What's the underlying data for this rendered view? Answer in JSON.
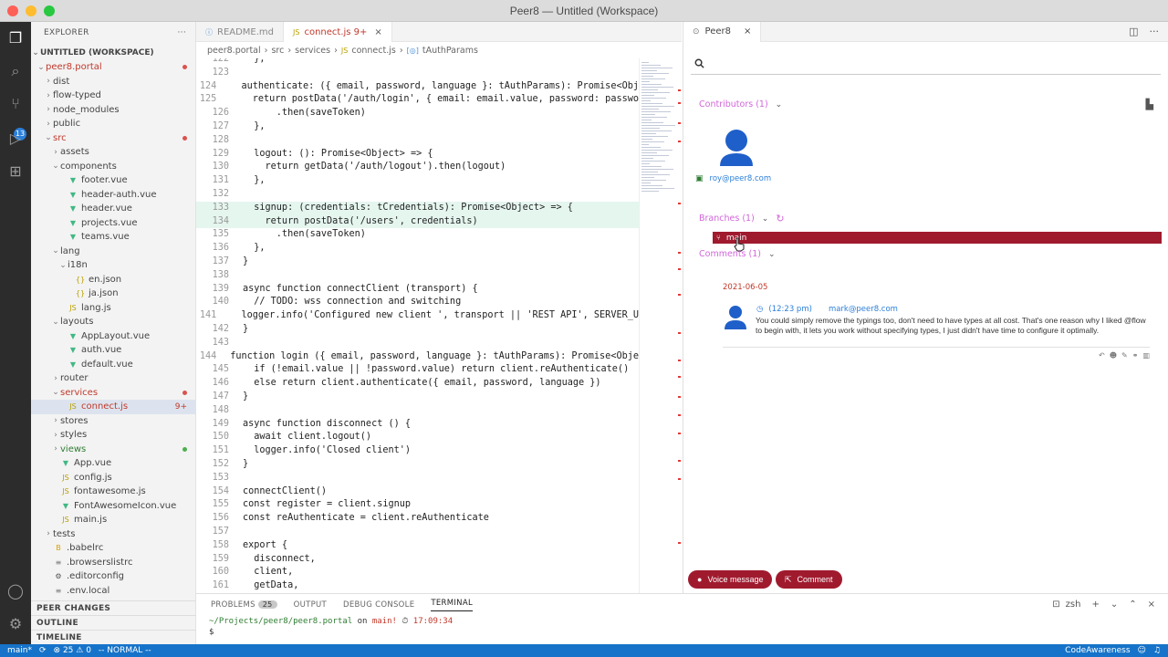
{
  "window": {
    "title": "Peer8 — Untitled (Workspace)"
  },
  "sidebar": {
    "header": "EXPLORER",
    "workspace": "UNTITLED (WORKSPACE)",
    "items": [
      {
        "label": "peer8.portal",
        "depth": 0,
        "chev": "v",
        "kind": "folder",
        "color": "red",
        "dot": "#d9534f"
      },
      {
        "label": "dist",
        "depth": 1,
        "chev": ">",
        "kind": "folder",
        "color": ""
      },
      {
        "label": "flow-typed",
        "depth": 1,
        "chev": ">",
        "kind": "folder",
        "color": ""
      },
      {
        "label": "node_modules",
        "depth": 1,
        "chev": ">",
        "kind": "folder",
        "color": ""
      },
      {
        "label": "public",
        "depth": 1,
        "chev": ">",
        "kind": "folder",
        "color": ""
      },
      {
        "label": "src",
        "depth": 1,
        "chev": "v",
        "kind": "folder",
        "color": "red",
        "dot": "#d9534f"
      },
      {
        "label": "assets",
        "depth": 2,
        "chev": ">",
        "kind": "folder",
        "color": ""
      },
      {
        "label": "components",
        "depth": 2,
        "chev": "v",
        "kind": "folder",
        "color": ""
      },
      {
        "label": "footer.vue",
        "depth": 3,
        "chev": "",
        "kind": "vue",
        "color": ""
      },
      {
        "label": "header-auth.vue",
        "depth": 3,
        "chev": "",
        "kind": "vue",
        "color": ""
      },
      {
        "label": "header.vue",
        "depth": 3,
        "chev": "",
        "kind": "vue",
        "color": ""
      },
      {
        "label": "projects.vue",
        "depth": 3,
        "chev": "",
        "kind": "vue",
        "color": ""
      },
      {
        "label": "teams.vue",
        "depth": 3,
        "chev": "",
        "kind": "vue",
        "color": ""
      },
      {
        "label": "lang",
        "depth": 2,
        "chev": "v",
        "kind": "folder",
        "color": ""
      },
      {
        "label": "i18n",
        "depth": 3,
        "chev": "v",
        "kind": "folder",
        "color": ""
      },
      {
        "label": "en.json",
        "depth": 4,
        "chev": "",
        "kind": "json",
        "color": ""
      },
      {
        "label": "ja.json",
        "depth": 4,
        "chev": "",
        "kind": "json",
        "color": ""
      },
      {
        "label": "lang.js",
        "depth": 3,
        "chev": "",
        "kind": "js",
        "color": ""
      },
      {
        "label": "layouts",
        "depth": 2,
        "chev": "v",
        "kind": "folder",
        "color": ""
      },
      {
        "label": "AppLayout.vue",
        "depth": 3,
        "chev": "",
        "kind": "vue",
        "color": ""
      },
      {
        "label": "auth.vue",
        "depth": 3,
        "chev": "",
        "kind": "vue",
        "color": ""
      },
      {
        "label": "default.vue",
        "depth": 3,
        "chev": "",
        "kind": "vue",
        "color": ""
      },
      {
        "label": "router",
        "depth": 2,
        "chev": ">",
        "kind": "folder",
        "color": ""
      },
      {
        "label": "services",
        "depth": 2,
        "chev": "v",
        "kind": "folder",
        "color": "red",
        "dot": "#d9534f"
      },
      {
        "label": "connect.js",
        "depth": 3,
        "chev": "",
        "kind": "js",
        "color": "red",
        "badge": "9+",
        "selected": true
      },
      {
        "label": "stores",
        "depth": 2,
        "chev": ">",
        "kind": "folder",
        "color": ""
      },
      {
        "label": "styles",
        "depth": 2,
        "chev": ">",
        "kind": "folder",
        "color": ""
      },
      {
        "label": "views",
        "depth": 2,
        "chev": ">",
        "kind": "folder",
        "color": "green",
        "dot": "#4caf50"
      },
      {
        "label": "App.vue",
        "depth": 2,
        "chev": "",
        "kind": "vue",
        "color": ""
      },
      {
        "label": "config.js",
        "depth": 2,
        "chev": "",
        "kind": "js",
        "color": ""
      },
      {
        "label": "fontawesome.js",
        "depth": 2,
        "chev": "",
        "kind": "js",
        "color": ""
      },
      {
        "label": "FontAwesomeIcon.vue",
        "depth": 2,
        "chev": "",
        "kind": "vue",
        "color": ""
      },
      {
        "label": "main.js",
        "depth": 2,
        "chev": "",
        "kind": "js",
        "color": ""
      },
      {
        "label": "tests",
        "depth": 1,
        "chev": ">",
        "kind": "folder",
        "color": ""
      },
      {
        "label": ".babelrc",
        "depth": 1,
        "chev": "",
        "kind": "babel",
        "color": ""
      },
      {
        "label": ".browserslistrc",
        "depth": 1,
        "chev": "",
        "kind": "text",
        "color": ""
      },
      {
        "label": ".editorconfig",
        "depth": 1,
        "chev": "",
        "kind": "gear",
        "color": ""
      },
      {
        "label": ".env.local",
        "depth": 1,
        "chev": "",
        "kind": "text",
        "color": ""
      }
    ],
    "bottom": [
      "PEER CHANGES",
      "OUTLINE",
      "TIMELINE"
    ]
  },
  "editor": {
    "tabs": [
      {
        "label": "README.md",
        "icon": "ⓘ",
        "active": false,
        "extra": ""
      },
      {
        "label": "connect.js 9+",
        "icon": "JS",
        "active": true,
        "extra": "×"
      }
    ],
    "breadcrumb": [
      "peer8.portal",
      "src",
      "services",
      "connect.js",
      "tAuthParams"
    ],
    "lines": [
      {
        "n": "122",
        "t": "  },",
        "hl": false
      },
      {
        "n": "123",
        "t": "",
        "hl": false
      },
      {
        "n": "124",
        "t": "  authenticate: ({ email, password, language }: tAuthParams): Promise<Obj",
        "hl": false
      },
      {
        "n": "125",
        "t": "    return postData('/auth/login', { email: email.value, password: passwo",
        "hl": false
      },
      {
        "n": "126",
        "t": "      .then(saveToken)",
        "hl": false
      },
      {
        "n": "127",
        "t": "  },",
        "hl": false
      },
      {
        "n": "128",
        "t": "",
        "hl": false
      },
      {
        "n": "129",
        "t": "  logout: (): Promise<Object> => {",
        "hl": false
      },
      {
        "n": "130",
        "t": "    return getData('/auth/logout').then(logout)",
        "hl": false
      },
      {
        "n": "131",
        "t": "  },",
        "hl": false
      },
      {
        "n": "132",
        "t": "",
        "hl": false
      },
      {
        "n": "133",
        "t": "  signup: (credentials: tCredentials): Promise<Object> => {",
        "hl": true
      },
      {
        "n": "134",
        "t": "    return postData('/users', credentials)",
        "hl": true
      },
      {
        "n": "135",
        "t": "      .then(saveToken)",
        "hl": false
      },
      {
        "n": "136",
        "t": "  },",
        "hl": false
      },
      {
        "n": "137",
        "t": "}",
        "hl": false
      },
      {
        "n": "138",
        "t": "",
        "hl": false
      },
      {
        "n": "139",
        "t": "async function connectClient (transport) {",
        "hl": false
      },
      {
        "n": "140",
        "t": "  // TODO: wss connection and switching",
        "hl": false
      },
      {
        "n": "141",
        "t": "  logger.info('Configured new client ', transport || 'REST API', SERVER_U",
        "hl": false
      },
      {
        "n": "142",
        "t": "}",
        "hl": false
      },
      {
        "n": "143",
        "t": "",
        "hl": false
      },
      {
        "n": "144",
        "t": "function login ({ email, password, language }: tAuthParams): Promise<Obje",
        "hl": false
      },
      {
        "n": "145",
        "t": "  if (!email.value || !password.value) return client.reAuthenticate()",
        "hl": false
      },
      {
        "n": "146",
        "t": "  else return client.authenticate({ email, password, language })",
        "hl": false
      },
      {
        "n": "147",
        "t": "}",
        "hl": false
      },
      {
        "n": "148",
        "t": "",
        "hl": false
      },
      {
        "n": "149",
        "t": "async function disconnect () {",
        "hl": false
      },
      {
        "n": "150",
        "t": "  await client.logout()",
        "hl": false
      },
      {
        "n": "151",
        "t": "  logger.info('Closed client')",
        "hl": false
      },
      {
        "n": "152",
        "t": "}",
        "hl": false
      },
      {
        "n": "153",
        "t": "",
        "hl": false
      },
      {
        "n": "154",
        "t": "connectClient()",
        "hl": false
      },
      {
        "n": "155",
        "t": "const register = client.signup",
        "hl": false
      },
      {
        "n": "156",
        "t": "const reAuthenticate = client.reAuthenticate",
        "hl": false
      },
      {
        "n": "157",
        "t": "",
        "hl": false
      },
      {
        "n": "158",
        "t": "export {",
        "hl": false
      },
      {
        "n": "159",
        "t": "  disconnect,",
        "hl": false
      },
      {
        "n": "160",
        "t": "  client,",
        "hl": false
      },
      {
        "n": "161",
        "t": "  getData,",
        "hl": false
      }
    ]
  },
  "panel": {
    "tabs": [
      "PROBLEMS",
      "OUTPUT",
      "DEBUG CONSOLE",
      "TERMINAL"
    ],
    "problems_count": "25",
    "shell": "zsh",
    "prompt_path": "~/Projects/peer8/peer8.portal",
    "prompt_on": "on",
    "prompt_branch": " main!",
    "prompt_time": " 17:09:34",
    "prompt_symbol": "$"
  },
  "status": {
    "branch": "main*",
    "problems": "⊗ 25 ⚠ 0",
    "mode": "-- NORMAL --",
    "right": "CodeAwareness"
  },
  "peer8": {
    "tab_label": "Peer8",
    "search_placeholder": "",
    "contributors_label": "Contributors (1)",
    "contributor_email": "roy@peer8.com",
    "branches_label": "Branches (1)",
    "branch_name": "main",
    "comments_label": "Comments (1)",
    "comment_date": "2021-06-05",
    "comment_time": "(12:23 pm)",
    "comment_author": "mark@peer8.com",
    "comment_text": "You could simply remove the typings too, don't need to have types at all cost. That's one reason why I liked @flow to begin with, it lets you work without specifying types, I just didn't have time to configure it optimally.",
    "voice_button": "Voice message",
    "comment_button": "Comment",
    "accent": "#a01a2e",
    "section_color": "#d166d9"
  }
}
